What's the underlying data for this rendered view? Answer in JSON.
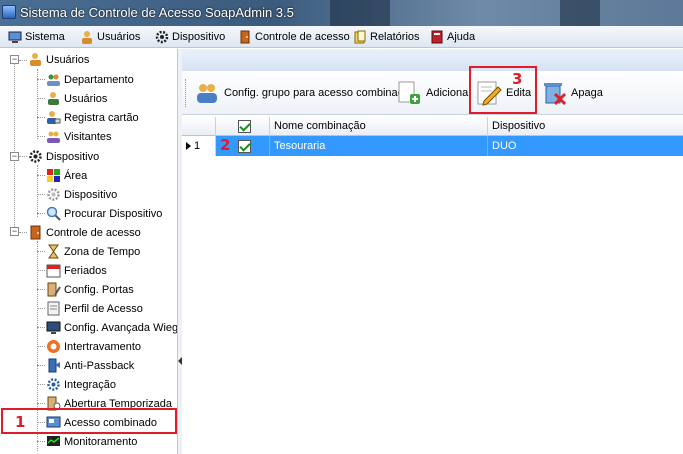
{
  "window": {
    "title": "Sistema de Controle de Acesso SoapAdmin 3.5"
  },
  "menu": [
    {
      "label": "Sistema",
      "icon": "computer-icon"
    },
    {
      "label": "Usuários",
      "icon": "users-icon"
    },
    {
      "label": "Dispositivo",
      "icon": "gear-icon"
    },
    {
      "label": "Controle de acesso",
      "icon": "door-icon"
    },
    {
      "label": "Relatórios",
      "icon": "reports-icon"
    },
    {
      "label": "Ajuda",
      "icon": "help-book-icon"
    }
  ],
  "tree": {
    "groups": [
      {
        "label": "Usuários",
        "expander": "−",
        "items": [
          "Departamento",
          "Usuários",
          "Registra cartão",
          "Visitantes"
        ]
      },
      {
        "label": "Dispositivo",
        "expander": "−",
        "items": [
          "Área",
          "Dispositivo",
          "Procurar Dispositivo"
        ]
      },
      {
        "label": "Controle de acesso",
        "expander": "−",
        "items": [
          "Zona de Tempo",
          "Feriados",
          "Config. Portas",
          "Perfil de Acesso",
          "Config. Avançada Wiegand",
          "Intertravamento",
          "Anti-Passback",
          "Integração",
          "Abertura Temporizada",
          "Acesso combinado",
          "Monitoramento"
        ]
      }
    ]
  },
  "toolbar": {
    "config_label": "Config. grupo para acesso combinado",
    "add_label": "Adiciona",
    "edit_label": "Edita",
    "delete_label": "Apaga"
  },
  "grid": {
    "columns": [
      "",
      "",
      "Nome combinação",
      "Dispositivo"
    ],
    "rows": [
      {
        "index": "1",
        "checked": true,
        "name": "Tesouraria",
        "device": "DUO",
        "selected": true
      }
    ]
  },
  "annotations": {
    "n1": "1",
    "n2": "2",
    "n3": "3"
  },
  "colors": {
    "annotation": "#e01b2a",
    "selection": "#3399ff"
  }
}
